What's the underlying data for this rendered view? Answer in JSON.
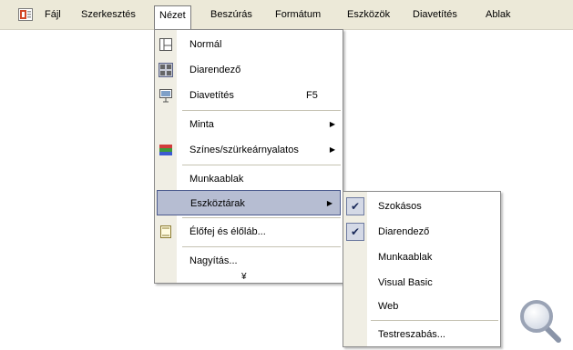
{
  "menubar": {
    "items": [
      {
        "label": "Fájl"
      },
      {
        "label": "Szerkesztés"
      },
      {
        "label": "Nézet"
      },
      {
        "label": "Beszúrás"
      },
      {
        "label": "Formátum"
      },
      {
        "label": "Eszközök"
      },
      {
        "label": "Diavetítés"
      },
      {
        "label": "Ablak"
      }
    ],
    "active": "Nézet"
  },
  "view_menu": {
    "items": [
      {
        "label": "Normál",
        "icon": "normal-view-icon"
      },
      {
        "label": "Diarendező",
        "icon": "slide-sorter-icon"
      },
      {
        "label": "Diavetítés",
        "icon": "slide-show-icon",
        "shortcut": "F5"
      },
      {
        "label": "Minta",
        "has_submenu": true
      },
      {
        "label": "Színes/szürkeárnyalatos",
        "icon": "color-grayscale-icon",
        "has_submenu": true
      },
      {
        "label": "Munkaablak"
      },
      {
        "label": "Eszköztárak",
        "has_submenu": true,
        "highlighted": true
      },
      {
        "label": "Élőfej és élőláb...",
        "icon": "header-footer-icon"
      },
      {
        "label": "Nagyítás..."
      }
    ],
    "expand_glyph": "¥"
  },
  "toolbars_submenu": {
    "items": [
      {
        "label": "Szokásos",
        "checked": true
      },
      {
        "label": "Diarendező",
        "checked": true
      },
      {
        "label": "Munkaablak",
        "checked": false
      },
      {
        "label": "Visual Basic",
        "checked": false
      },
      {
        "label": "Web",
        "checked": false
      },
      {
        "label": "Testreszabás...",
        "checked": false
      }
    ],
    "check_glyph": "✔"
  },
  "colors": {
    "menubar_bg": "#ece9d8",
    "highlight_bg": "#b6bdd2",
    "highlight_border": "#4b5a8e"
  }
}
